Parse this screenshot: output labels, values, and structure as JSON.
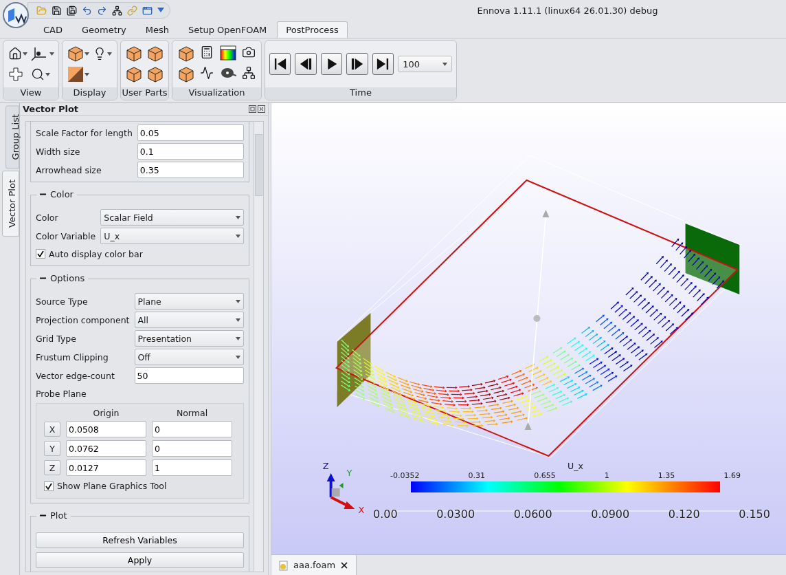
{
  "window": {
    "title": "Ennova 1.11.1 (linux64 26.01.30) debug"
  },
  "menu_tabs": [
    {
      "label": "CAD",
      "selected": false
    },
    {
      "label": "Geometry",
      "selected": false
    },
    {
      "label": "Mesh",
      "selected": false
    },
    {
      "label": "Setup OpenFOAM",
      "selected": false
    },
    {
      "label": "PostProcess",
      "selected": true
    }
  ],
  "ribbon": {
    "groups": [
      {
        "kind": "view",
        "label": "View"
      },
      {
        "kind": "display",
        "label": "Display"
      },
      {
        "kind": "user_parts",
        "label": "User Parts"
      },
      {
        "kind": "visualization",
        "label": "Visualization"
      },
      {
        "kind": "time",
        "label": "Time",
        "step": "100"
      }
    ]
  },
  "side_tabs": [
    {
      "label": "Group List",
      "selected": false
    },
    {
      "label": "Vector Plot",
      "selected": true
    }
  ],
  "panel": {
    "title": "Vector Plot",
    "sections": [
      {
        "kind": "fields",
        "rows": [
          {
            "kind": "input",
            "label": "Scale Factor for length",
            "value": "0.05"
          },
          {
            "kind": "input",
            "label": "Width size",
            "value": "0.1"
          },
          {
            "kind": "input",
            "label": "Arrowhead size",
            "value": "0.35"
          }
        ]
      },
      {
        "kind": "group",
        "title": "Color",
        "expanded": true,
        "rows": [
          {
            "kind": "select",
            "label": "Color",
            "value": "Scalar Field"
          },
          {
            "kind": "select",
            "label": "Color Variable",
            "value": "U_x"
          },
          {
            "kind": "checkbox",
            "label": "Auto display color bar",
            "checked": true
          }
        ]
      },
      {
        "kind": "group",
        "title": "Options",
        "expanded": true,
        "rows": [
          {
            "kind": "select",
            "label": "Source Type",
            "value": "Plane"
          },
          {
            "kind": "select",
            "label": "Projection component",
            "value": "All"
          },
          {
            "kind": "select",
            "label": "Grid Type",
            "value": "Presentation"
          },
          {
            "kind": "select",
            "label": "Frustum Clipping",
            "value": "Off"
          },
          {
            "kind": "input",
            "label": "Vector edge-count",
            "value": "50"
          },
          {
            "kind": "label",
            "label": "Probe Plane"
          },
          {
            "kind": "probe",
            "headers": [
              "Origin",
              "Normal"
            ],
            "rows": [
              {
                "axis": "X",
                "origin": "0.0508",
                "normal": "0"
              },
              {
                "axis": "Y",
                "origin": "0.0762",
                "normal": "0"
              },
              {
                "axis": "Z",
                "origin": "0.0127",
                "normal": "1"
              }
            ],
            "checkbox": {
              "label": "Show Plane Graphics Tool",
              "checked": true
            }
          }
        ]
      },
      {
        "kind": "group",
        "title": "Plot",
        "expanded": true,
        "rows": [
          {
            "kind": "button",
            "label": "Refresh Variables"
          },
          {
            "kind": "button",
            "label": "Apply"
          }
        ]
      }
    ]
  },
  "viewport": {
    "color_legend": {
      "title": "U_x",
      "labels": [
        "-0.0352",
        "0.31",
        "0.655",
        "1",
        "1.35",
        "1.69"
      ]
    },
    "scale_ruler": {
      "labels": [
        "0.00",
        "0.0300",
        "0.0600",
        "0.0900",
        "0.120",
        "0.150"
      ]
    },
    "axes_triad": {
      "x": "X",
      "y": "Y",
      "z": "Z"
    }
  },
  "document_tabs": [
    {
      "label": "aaa.foam",
      "selected": true
    }
  ]
}
